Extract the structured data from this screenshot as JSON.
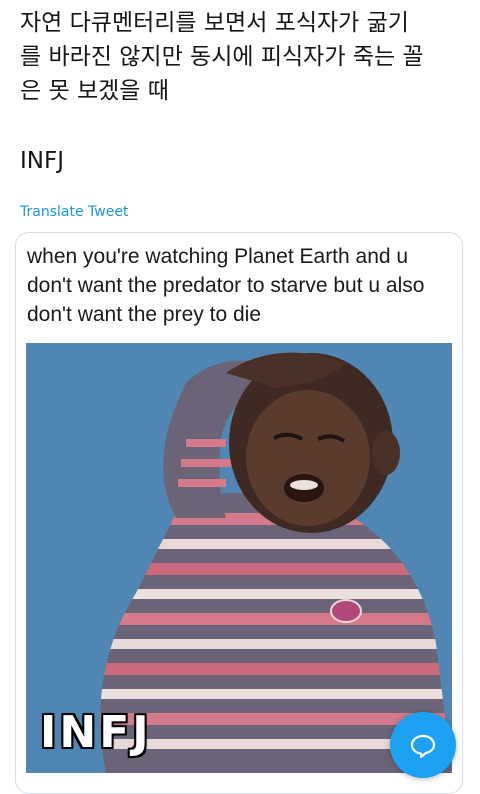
{
  "tweet": {
    "text": "자연 다큐멘터리를 보면서 포식자가 굶기\n를 바라진 않지만 동시에 피식자가 죽는 꼴\n은 못 보겠을 때",
    "tag": "INFJ",
    "translate_label": "Translate Tweet"
  },
  "quoted_tweet": {
    "caption": "when you're watching Planet Earth and u don't want the predator to starve but u also don't want the prey to die",
    "image_overlay_text": "INFJ"
  },
  "reply_button": {
    "icon": "speech-bubble-icon"
  },
  "colors": {
    "link": "#1b95e0",
    "fab": "#1da1f2",
    "image_background": "#4f86b4"
  }
}
